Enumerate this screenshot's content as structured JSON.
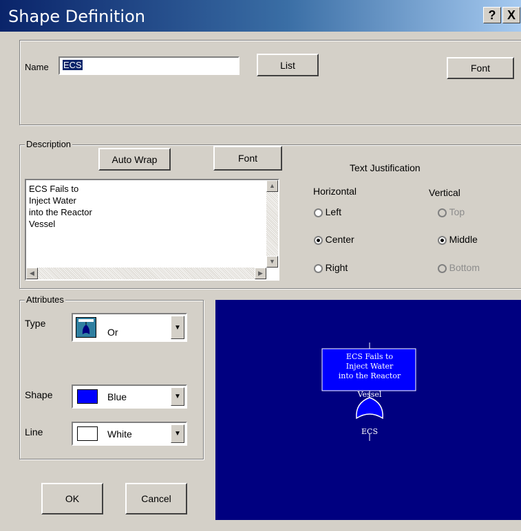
{
  "window": {
    "title": "Shape Definition",
    "help_label": "?",
    "close_label": "X"
  },
  "name_section": {
    "label": "Name",
    "value": "ECS",
    "list_button": "List",
    "font_button": "Font"
  },
  "description": {
    "legend": "Description",
    "auto_wrap_button": "Auto Wrap",
    "font_button": "Font",
    "lines": [
      "ECS Fails to",
      "Inject Water",
      "into the Reactor",
      "Vessel"
    ]
  },
  "justification": {
    "title": "Text Justification",
    "horizontal_label": "Horizontal",
    "vertical_label": "Vertical",
    "horizontal_options": [
      {
        "label": "Left",
        "checked": false
      },
      {
        "label": "Center",
        "checked": true
      },
      {
        "label": "Right",
        "checked": false
      }
    ],
    "vertical_options": [
      {
        "label": "Top",
        "checked": false,
        "disabled": true
      },
      {
        "label": "Middle",
        "checked": true,
        "disabled": false
      },
      {
        "label": "Bottom",
        "checked": false,
        "disabled": true
      }
    ]
  },
  "attributes": {
    "legend": "Attributes",
    "type_label": "Type",
    "type_value": "Or",
    "type_icon": "or-gate-icon",
    "shape_label": "Shape",
    "shape_value": "Blue",
    "shape_color": "#0000ff",
    "line_label": "Line",
    "line_value": "White",
    "line_color": "#ffffff"
  },
  "buttons": {
    "ok": "OK",
    "cancel": "Cancel"
  },
  "preview": {
    "background": "#000080",
    "box_lines": [
      "ECS Fails to",
      "Inject Water",
      "into the Reactor",
      "Vessel"
    ],
    "gate_label": "ECS"
  }
}
